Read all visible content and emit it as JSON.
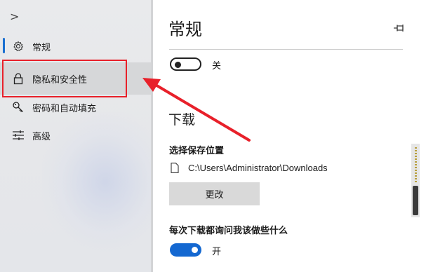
{
  "sidebar": {
    "collapse_glyph": ">",
    "items": [
      {
        "label": "常规",
        "icon": "gear-icon"
      },
      {
        "label": "隐私和安全性",
        "icon": "lock-icon"
      },
      {
        "label": "密码和自动填充",
        "icon": "key-icon"
      },
      {
        "label": "高级",
        "icon": "sliders-icon"
      }
    ],
    "active_index": 0,
    "highlighted_index": 1
  },
  "main": {
    "title": "常规",
    "toggle_top": {
      "label": "关",
      "state": "off"
    },
    "downloads": {
      "section_title": "下载",
      "location_label": "选择保存位置",
      "path": "C:\\Users\\Administrator\\Downloads",
      "change_button": "更改",
      "ask_label": "每次下载都询问我该做些什么",
      "ask_toggle": {
        "label": "开",
        "state": "on"
      }
    }
  },
  "colors": {
    "accent": "#1468d1",
    "annotation_red": "#e8202a"
  }
}
